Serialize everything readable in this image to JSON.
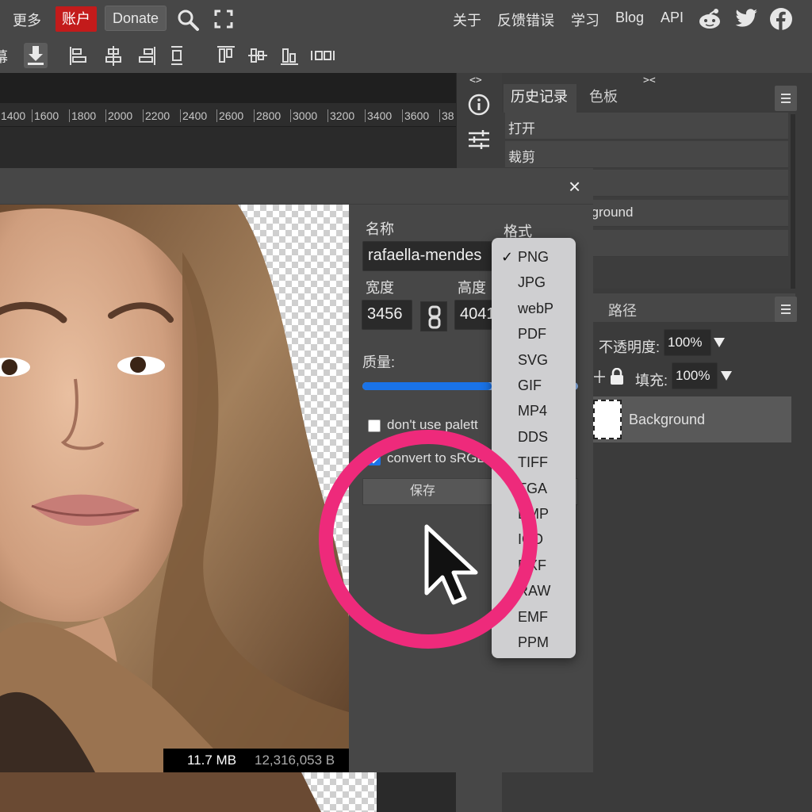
{
  "menubar": {
    "more": "更多",
    "account": "账户",
    "donate": "Donate",
    "about": "关于",
    "feedback": "反馈错误",
    "learn": "学习",
    "blog": "Blog",
    "api": "API",
    "cut_left_char": "幕"
  },
  "ruler": {
    "ticks": [
      "1400",
      "1600",
      "1800",
      "2000",
      "2200",
      "2400",
      "2600",
      "2800",
      "3000",
      "3200",
      "3400",
      "3600",
      "38"
    ]
  },
  "sidebar_toggle": {
    "left_arrows": "<>",
    "right_arrows": "><"
  },
  "history_panel": {
    "tabs": [
      "历史记录",
      "色板"
    ],
    "items": [
      "打开",
      "裁剪",
      "",
      "kground",
      ""
    ]
  },
  "layers_panel": {
    "tab_paths": "路径",
    "opacity_label": "不透明度:",
    "opacity_value": "100%",
    "fill_label": "填充:",
    "fill_value": "100%",
    "layer_name": "Background"
  },
  "export_dialog": {
    "close": "×",
    "name_label": "名称",
    "format_label": "格式",
    "name_value": "rafaella-mendes",
    "width_label": "宽度",
    "height_label": "高度",
    "width_value": "3456",
    "height_value": "4041",
    "quality_label": "质量:",
    "quality_level": 0.6,
    "dont_use_palette": "don't use palett",
    "dont_use_palette_checked": false,
    "convert_srgb": "convert to sRGB",
    "convert_srgb_checked": true,
    "save_button": "保存",
    "size_mb": "11.7 MB",
    "size_bytes": "12,316,053 B"
  },
  "format_menu": {
    "selected": "PNG",
    "check": "✓",
    "options": [
      "PNG",
      "JPG",
      "webP",
      "PDF",
      "SVG",
      "GIF",
      "MP4",
      "DDS",
      "TIFF",
      "TGA",
      "BMP",
      "ICO",
      "DXF",
      "RAW",
      "EMF",
      "PPM"
    ]
  },
  "colors": {
    "accent_blue": "#1a73e8",
    "account_red": "#c31b1b",
    "highlight_circle": "#ee2a7b"
  }
}
